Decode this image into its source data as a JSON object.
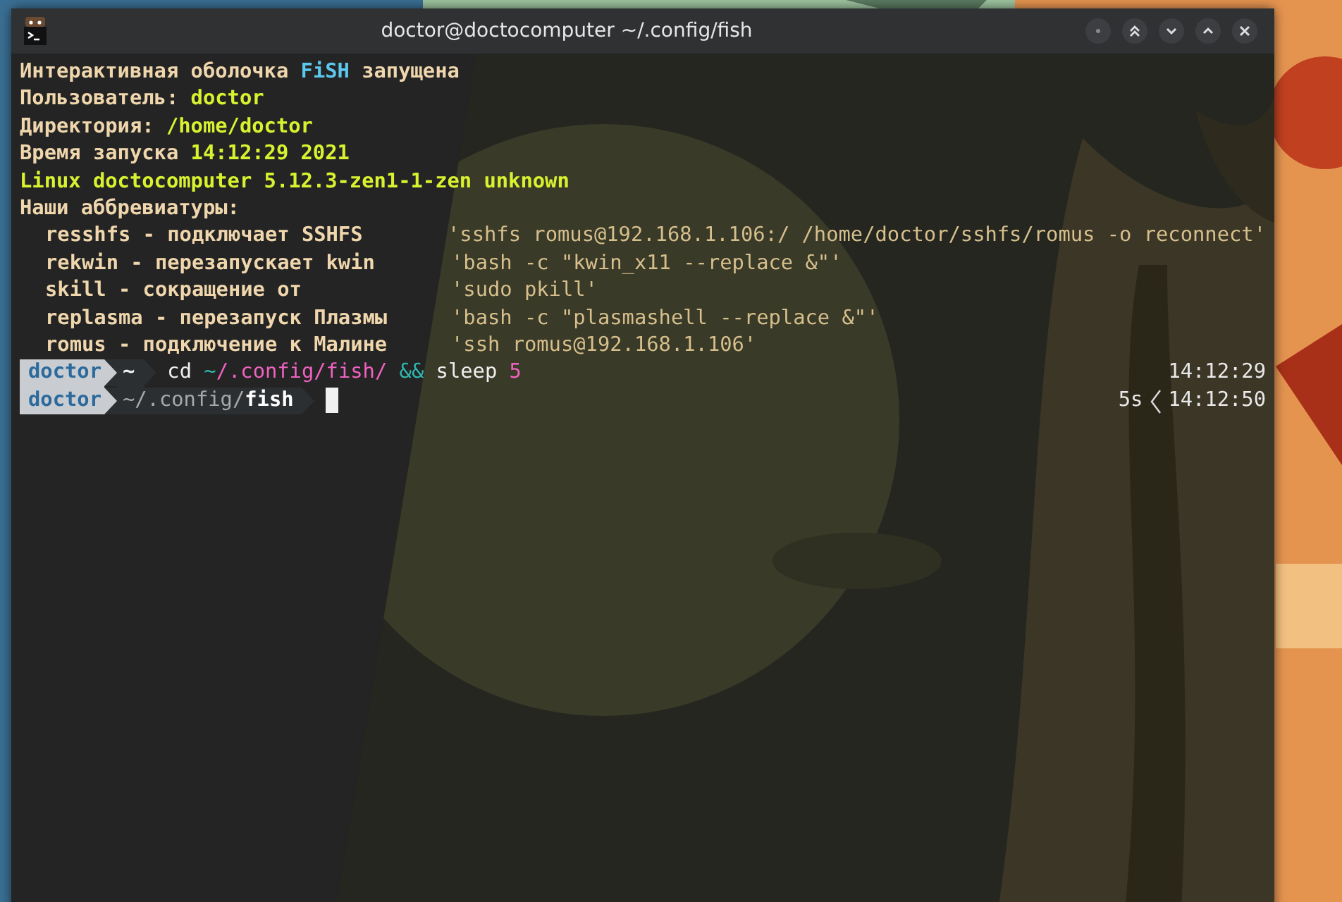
{
  "window": {
    "title": "doctor@doctocomputer ~/.config/fish"
  },
  "greeting": [
    [
      {
        "text": "Интерактивная оболочка ",
        "kind": "label"
      },
      {
        "text": "FiSH",
        "kind": "accent"
      },
      {
        "text": " запущена",
        "kind": "label"
      }
    ],
    [
      {
        "text": "Пользователь: ",
        "kind": "label"
      },
      {
        "text": "doctor",
        "kind": "value"
      }
    ],
    [
      {
        "text": "Директория: ",
        "kind": "label"
      },
      {
        "text": "/home/doctor",
        "kind": "value"
      }
    ],
    [
      {
        "text": "Время запуска ",
        "kind": "label"
      },
      {
        "text": "14:12:29 2021",
        "kind": "value"
      }
    ],
    [
      {
        "text": "Linux doctocomputer 5.12.3-zen1-1-zen unknown",
        "kind": "value"
      }
    ]
  ],
  "abbreviations": {
    "heading": "Наши аббревиатуры:",
    "items": [
      {
        "name": "resshfs - подключает SSHFS",
        "command": "'sshfs romus@192.168.1.106:/ /home/doctor/sshfs/romus -o reconnect'"
      },
      {
        "name": "rekwin - перезапускает kwin",
        "command": "'bash -c \"kwin_x11 --replace &\"'"
      },
      {
        "name": "skill - сокращение от",
        "command": "'sudo pkill'"
      },
      {
        "name": "replasma - перезапуск Плазмы",
        "command": "'bash -c \"plasmashell --replace &\"'"
      },
      {
        "name": "romus - подключение к Малине",
        "command": "'ssh romus@192.168.1.106'"
      }
    ]
  },
  "prompts": [
    {
      "user": "doctor",
      "path": [
        {
          "text": "~",
          "kind": "plain"
        }
      ],
      "command": [
        {
          "text": "cd ",
          "kind": "cmd"
        },
        {
          "text": "~",
          "kind": "op"
        },
        {
          "text": "/.config/fish/ ",
          "kind": "path"
        },
        {
          "text": "&&",
          "kind": "op"
        },
        {
          "text": " sleep ",
          "kind": "cmd"
        },
        {
          "text": "5",
          "kind": "path"
        }
      ],
      "cursor": false,
      "time": "14:12:29"
    },
    {
      "user": "doctor",
      "path": [
        {
          "text": "~/.config/",
          "kind": "dim"
        },
        {
          "text": "fish",
          "kind": "strong"
        }
      ],
      "cursor": true,
      "duration": "5s",
      "time": "14:12:50"
    }
  ]
}
